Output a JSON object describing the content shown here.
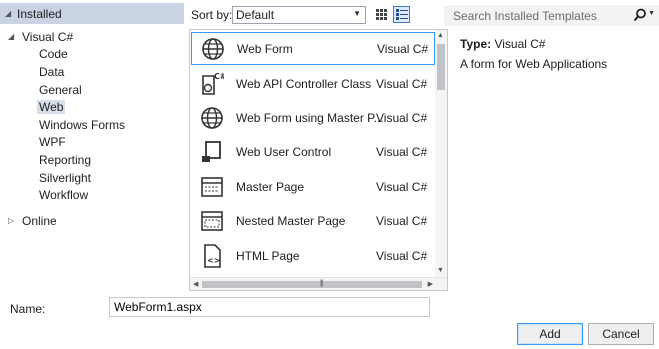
{
  "left_panel": {
    "header": "Installed",
    "tree": [
      {
        "label": "Visual C#",
        "expanded": true
      },
      {
        "label": "Code"
      },
      {
        "label": "Data"
      },
      {
        "label": "General"
      },
      {
        "label": "Web",
        "selected": true
      },
      {
        "label": "Windows Forms"
      },
      {
        "label": "WPF"
      },
      {
        "label": "Reporting"
      },
      {
        "label": "Silverlight"
      },
      {
        "label": "Workflow"
      }
    ],
    "online": "Online"
  },
  "toolbar": {
    "sort_label": "Sort by:",
    "sort_value": "Default",
    "search_placeholder": "Search Installed Templates"
  },
  "templates": [
    {
      "name": "Web Form",
      "lang": "Visual C#",
      "icon": "globe-icon",
      "selected": true
    },
    {
      "name": "Web API Controller Class",
      "lang": "Visual C#",
      "icon": "csharp-class-icon"
    },
    {
      "name": "Web Form using Master P...",
      "lang": "Visual C#",
      "icon": "globe-icon"
    },
    {
      "name": "Web User Control",
      "lang": "Visual C#",
      "icon": "user-control-icon"
    },
    {
      "name": "Master Page",
      "lang": "Visual C#",
      "icon": "master-page-icon"
    },
    {
      "name": "Nested Master Page",
      "lang": "Visual C#",
      "icon": "nested-master-page-icon"
    },
    {
      "name": "HTML Page",
      "lang": "Visual C#",
      "icon": "html-page-icon"
    }
  ],
  "detail": {
    "type_label": "Type:",
    "type_value": "Visual C#",
    "description": "A form for Web Applications"
  },
  "name_field": {
    "label": "Name:",
    "value": "WebForm1.aspx"
  },
  "buttons": {
    "add": "Add",
    "cancel": "Cancel"
  },
  "colors": {
    "header_bg": "#c9d3e4",
    "selection_border": "#3399ff",
    "selected_tree_bg": "#d8dee9"
  }
}
